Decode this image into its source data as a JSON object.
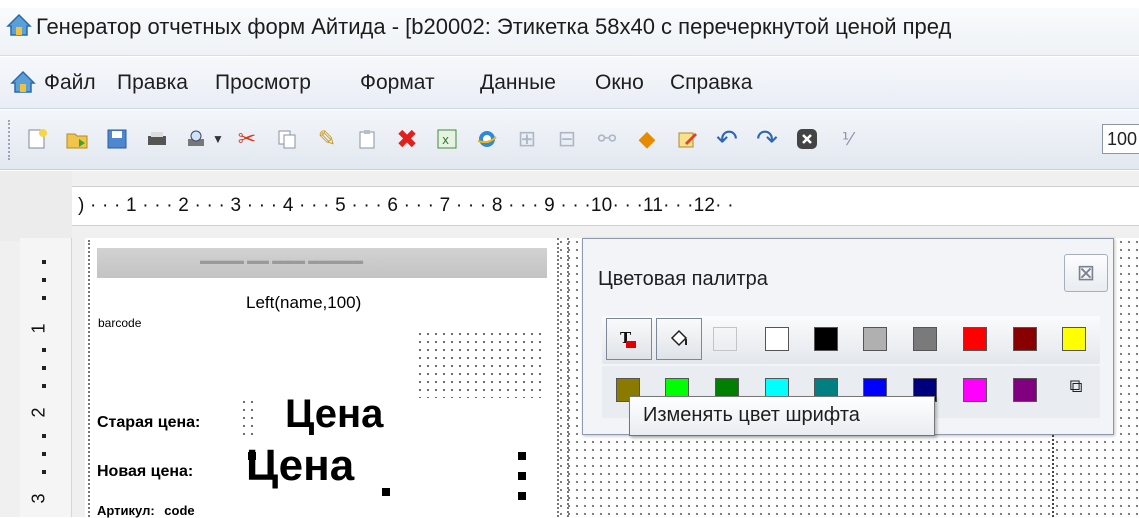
{
  "window": {
    "title": "Генератор отчетных форм Айтида - [b20002: Этикетка 58x40 с перечеркнутой ценой пред"
  },
  "menu": {
    "items": [
      "Файл",
      "Правка",
      "Просмотр",
      "Формат",
      "Данные",
      "Окно",
      "Справка"
    ]
  },
  "toolbar": {
    "icons": [
      "new-icon",
      "open-icon",
      "save-icon",
      "print-icon",
      "preview-icon",
      "dropdown-arrow-icon",
      "cut-icon",
      "copy-icon",
      "format-brush-icon",
      "paste-icon",
      "delete-icon",
      "excel-icon",
      "browser-icon",
      "group-icon",
      "ungroup-icon",
      "link-icon",
      "warning-icon",
      "edit-icon",
      "undo-icon",
      "redo-icon",
      "stop-icon",
      "grid-icon"
    ],
    "zoom_value": "100"
  },
  "ruler": {
    "horizontal": ") · · · 1 · · · 2 · · · 3 · · · 4 · · · 5 · · · 6 · · · 7 · · · 8 · · · 9 · · ·10· · ·11· · ·12· ·",
    "vertical": [
      "1",
      "2",
      "3"
    ]
  },
  "label": {
    "name_field": "Left(name,100)",
    "barcode_field": "barcode",
    "old_price_label": "Старая цена:",
    "old_price_value": "Цена",
    "new_price_label": "Новая цена:",
    "new_price_value": "Цена",
    "article_label": "Артикул:",
    "article_value": "code"
  },
  "palette": {
    "title": "Цветовая палитра",
    "row1_colors": [
      "#ffffff",
      "#ffffff",
      "#000000",
      "#b0b0b0",
      "#7a7a7a",
      "#ff0000",
      "#880000",
      "#ffff00"
    ],
    "row2_colors": [
      "#8a7a00",
      "#00ff00",
      "#008000",
      "#00ffff",
      "#008080",
      "#0000ff",
      "#00007f",
      "#ff00ff",
      "#800080"
    ],
    "tooltip": "Изменять цвет шрифта"
  }
}
